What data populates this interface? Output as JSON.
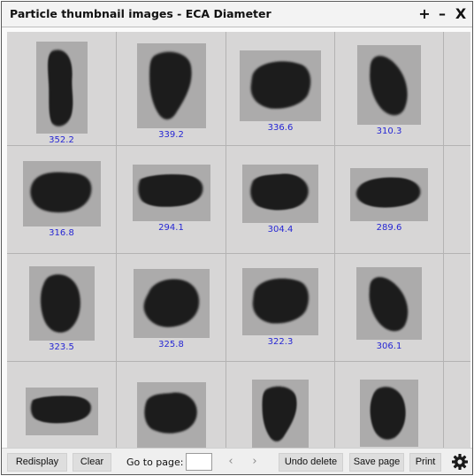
{
  "window": {
    "title": "Particle thumbnail images - ECA Diameter",
    "controls": {
      "add": "+",
      "minimize": "–",
      "close": "X"
    }
  },
  "thumbnails": [
    {
      "value": "352.2",
      "shape": "blob-tall"
    },
    {
      "value": "339.2",
      "shape": "blob-tall-pointed"
    },
    {
      "value": "336.6",
      "shape": "blob-wide-round"
    },
    {
      "value": "310.3",
      "shape": "blob-tall-tilted"
    },
    {
      "value": "316.8",
      "shape": "blob-wide-lobed"
    },
    {
      "value": "294.1",
      "shape": "blob-wide-flat"
    },
    {
      "value": "304.4",
      "shape": "blob-wide-bumpy"
    },
    {
      "value": "289.6",
      "shape": "blob-wide-smooth"
    },
    {
      "value": "323.5",
      "shape": "blob-oval"
    },
    {
      "value": "325.8",
      "shape": "blob-round"
    },
    {
      "value": "322.3",
      "shape": "blob-wide-round"
    },
    {
      "value": "306.1",
      "shape": "blob-tall-tilted"
    },
    {
      "value": "",
      "shape": "blob-wide-flat"
    },
    {
      "value": "",
      "shape": "blob-wide-bumpy"
    },
    {
      "value": "",
      "shape": "blob-tall-pointed"
    },
    {
      "value": "",
      "shape": "blob-oval"
    }
  ],
  "toolbar": {
    "redisplay": "Redisplay",
    "clear": "Clear",
    "goto_label": "Go to page:",
    "goto_value": "",
    "prev_icon": "‹",
    "next_icon": "›",
    "undo_delete": "Undo delete",
    "save_page": "Save page",
    "print": "Print",
    "settings_icon": "gear-icon"
  },
  "colors": {
    "caption": "#2626d4",
    "particle": "#1e1e1e",
    "thumb_bg": "#acabab",
    "cell_bg": "#d7d6d6"
  }
}
